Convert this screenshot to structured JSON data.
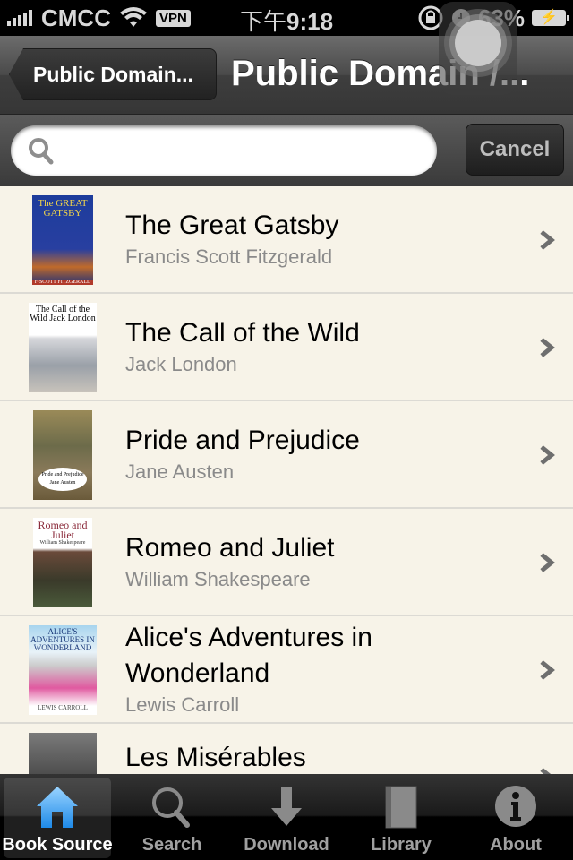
{
  "status_bar": {
    "carrier": "CMCC",
    "vpn_label": "VPN",
    "time_prefix": "下午",
    "time": "9:18",
    "battery_percent": "63%",
    "signal_bars": 5
  },
  "nav": {
    "back_label": "Public Domain...",
    "title": "Public Domain /..."
  },
  "search": {
    "value": "",
    "placeholder": "",
    "cancel_label": "Cancel"
  },
  "books": [
    {
      "title": "The Great Gatsby",
      "author": "Francis Scott Fitzgerald",
      "cover_text": "The GREAT GATSBY",
      "cover_footer": "F·SCOTT FITZGERALD"
    },
    {
      "title": "The Call of the Wild",
      "author": "Jack London",
      "cover_text": "The Call of the Wild Jack London"
    },
    {
      "title": "Pride and Prejudice",
      "author": "Jane Austen",
      "cover_text": "Pride and Prejudice Jane Austen"
    },
    {
      "title": "Romeo and Juliet",
      "author": "William Shakespeare",
      "cover_text": "Romeo and Juliet",
      "cover_sub": "William Shakespeare"
    },
    {
      "title": "Alice's Adventures in Wonderland",
      "author": "Lewis Carroll",
      "cover_text": "ALICE'S ADVENTURES IN WONDERLAND",
      "cover_footer": "LEWIS CARROLL"
    },
    {
      "title": "Les Misérables",
      "author": ""
    }
  ],
  "tabs": [
    {
      "label": "Book Source",
      "icon": "home-icon",
      "active": true
    },
    {
      "label": "Search",
      "icon": "search-icon",
      "active": false
    },
    {
      "label": "Download",
      "icon": "download-arrow-icon",
      "active": false
    },
    {
      "label": "Library",
      "icon": "book-icon",
      "active": false
    },
    {
      "label": "About",
      "icon": "info-icon",
      "active": false
    }
  ],
  "colors": {
    "list_background": "#f7f3e8",
    "active_tab_blue": "#3aa0f0",
    "secondary_text": "#8a8a8a"
  }
}
